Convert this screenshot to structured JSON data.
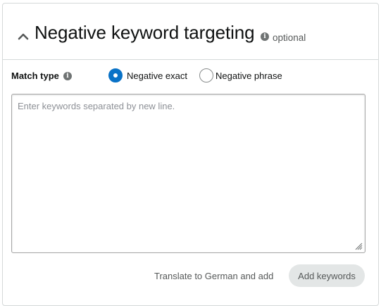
{
  "header": {
    "title": "Negative keyword targeting",
    "optional_label": "optional",
    "info_glyph": "i",
    "collapse_icon": "chevron-up-icon"
  },
  "match_type": {
    "label": "Match type",
    "info_glyph": "i",
    "options": [
      {
        "label": "Negative exact",
        "selected": true
      },
      {
        "label": "Negative phrase",
        "selected": false
      }
    ]
  },
  "keywords": {
    "placeholder": "Enter keywords separated by new line.",
    "value": ""
  },
  "actions": {
    "translate_label": "Translate to German and add",
    "add_label": "Add keywords"
  },
  "colors": {
    "accent": "#0972c7",
    "border": "#d5d9d9",
    "disabled_button_bg": "#e3e6e6",
    "muted_text": "#565959"
  }
}
